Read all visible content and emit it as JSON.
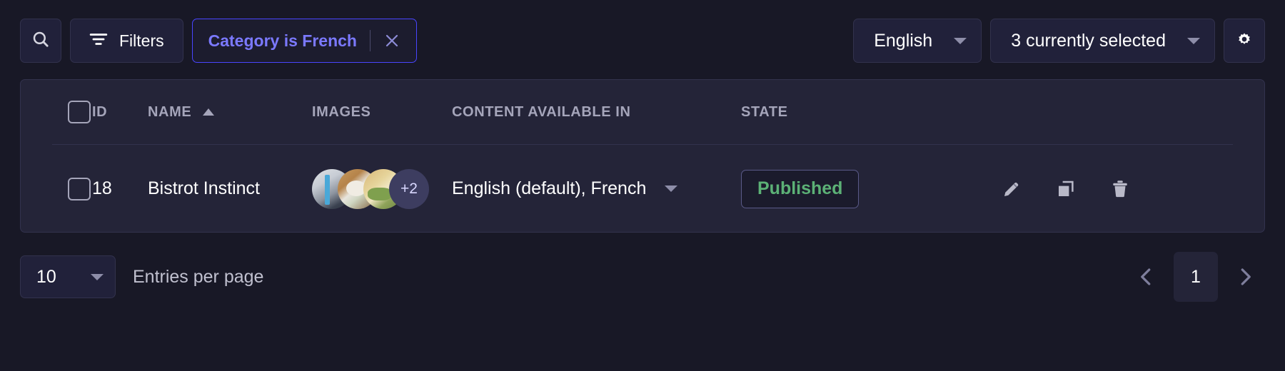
{
  "toolbar": {
    "search_icon": "search-icon",
    "filters_label": "Filters",
    "filters_icon": "filter-icon",
    "filter_chip": {
      "label": "Category is French",
      "close_icon": "close-icon",
      "text_color": "#7b79ff",
      "border_color": "#4945ff"
    },
    "locale_select": {
      "value": "English",
      "caret_icon": "chevron-down-icon"
    },
    "fields_select": {
      "value": "3 currently selected",
      "caret_icon": "chevron-down-icon"
    },
    "settings_icon": "gear-icon"
  },
  "table": {
    "columns": [
      {
        "key": "checkbox",
        "label": ""
      },
      {
        "key": "id",
        "label": "ID"
      },
      {
        "key": "name",
        "label": "NAME",
        "sorted": "asc",
        "sort_icon": "sort-ascending-arrow-icon"
      },
      {
        "key": "images",
        "label": "IMAGES"
      },
      {
        "key": "content_available_in",
        "label": "CONTENT AVAILABLE IN"
      },
      {
        "key": "state",
        "label": "STATE"
      }
    ],
    "rows": [
      {
        "id": "18",
        "name": "Bistrot Instinct",
        "images": {
          "visible_count": 3,
          "overflow_label": "+2"
        },
        "content_available_in": "English (default), French",
        "lang_caret_icon": "chevron-down-icon",
        "state": "Published",
        "state_color": "#5cb176",
        "actions": [
          {
            "name": "edit-icon",
            "label": "Edit"
          },
          {
            "name": "duplicate-icon",
            "label": "Duplicate"
          },
          {
            "name": "delete-icon",
            "label": "Delete"
          }
        ]
      }
    ]
  },
  "footer": {
    "entries_per_page_value": "10",
    "entries_per_page_label": "Entries per page",
    "entries_caret_icon": "chevron-down-icon",
    "pagination": {
      "prev_icon": "chevron-left-icon",
      "next_icon": "chevron-right-icon",
      "current_page": "1"
    }
  },
  "colors": {
    "page_background": "#181826",
    "card_background": "#242438",
    "control_background": "#21213a",
    "border": "#32324d",
    "accent_purple": "#4945ff",
    "success_green": "#5cb176",
    "muted_text": "#a5a5ba"
  }
}
